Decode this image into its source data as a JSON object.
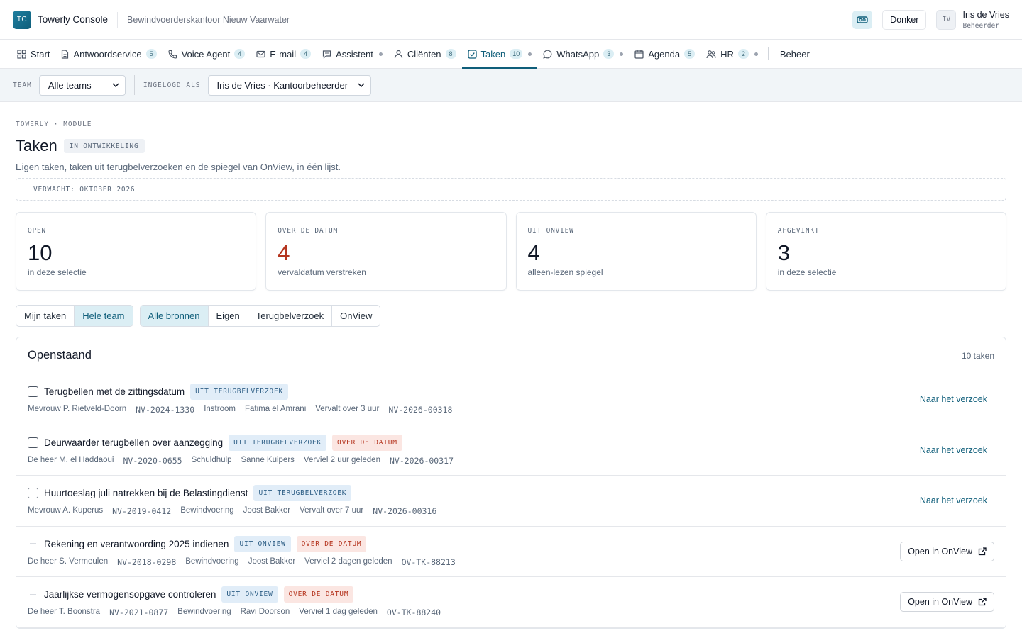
{
  "header": {
    "logo_text": "TC",
    "app_title": "Towerly Console",
    "office": "Bewindvoerderskantoor Nieuw Vaarwater",
    "theme_label": "Donker",
    "user": {
      "initials": "IV",
      "name": "Iris de Vries",
      "role": "Beheerder"
    }
  },
  "nav": {
    "items": [
      {
        "label": "Start",
        "icon": "grid-icon"
      },
      {
        "label": "Antwoordservice",
        "icon": "document-icon",
        "count": "5"
      },
      {
        "label": "Voice Agent",
        "icon": "phone-icon",
        "count": "4"
      },
      {
        "label": "E-mail",
        "icon": "mail-icon",
        "count": "4"
      },
      {
        "label": "Assistent",
        "icon": "chat-icon"
      },
      {
        "label": "Cliënten",
        "icon": "user-icon",
        "count": "8"
      },
      {
        "label": "Taken",
        "icon": "checkbox-icon",
        "count": "10"
      },
      {
        "label": "WhatsApp",
        "icon": "whatsapp-icon",
        "count": "3"
      },
      {
        "label": "Agenda",
        "icon": "calendar-icon",
        "count": "5"
      },
      {
        "label": "HR",
        "icon": "people-icon",
        "count": "2"
      }
    ],
    "admin_label": "Beheer"
  },
  "filters": {
    "team_label": "TEAM",
    "team_value": "Alle teams",
    "login_label": "INGELOGD ALS",
    "login_value": "Iris de Vries · Kantoorbeheerder"
  },
  "page": {
    "eyebrow": "TOWERLY · MODULE",
    "title": "Taken",
    "status": "IN ONTWIKKELING",
    "subtitle": "Eigen taken, taken uit terugbelverzoeken en de spiegel van OnView, in één lijst.",
    "expected": "VERWACHT: OKTOBER 2026"
  },
  "stats": [
    {
      "label": "OPEN",
      "value": "10",
      "sub": "in deze selectie"
    },
    {
      "label": "OVER DE DATUM",
      "value": "4",
      "sub": "vervaldatum verstreken"
    },
    {
      "label": "UIT ONVIEW",
      "value": "4",
      "sub": "alleen-lezen spiegel"
    },
    {
      "label": "AFGEVINKT",
      "value": "3",
      "sub": "in deze selectie"
    }
  ],
  "scope_tabs": [
    "Mijn taken",
    "Hele team"
  ],
  "source_tabs": [
    "Alle bronnen",
    "Eigen",
    "Terugbelverzoek",
    "OnView"
  ],
  "list": {
    "title": "Openstaand",
    "count": "10 taken",
    "tasks": [
      {
        "title": "Terugbellen met de zittingsdatum",
        "source_tag": "UIT TERUGBELVERZOEK",
        "meta": [
          "Mevrouw P. Rietveld-Doorn",
          "NV-2024-1330",
          "Instroom",
          "Fatima el Amrani",
          "Vervalt over 3 uur",
          "NV-2026-00318"
        ],
        "action": "Naar het verzoek"
      },
      {
        "title": "Deurwaarder terugbellen over aanzegging",
        "source_tag": "UIT TERUGBELVERZOEK",
        "status_tag": "OVER DE DATUM",
        "meta": [
          "De heer M. el Haddaoui",
          "NV-2020-0655",
          "Schuldhulp",
          "Sanne Kuipers",
          "Verviel 2 uur geleden",
          "NV-2026-00317"
        ],
        "action": "Naar het verzoek"
      },
      {
        "title": "Huurtoeslag juli natrekken bij de Belastingdienst",
        "source_tag": "UIT TERUGBELVERZOEK",
        "meta": [
          "Mevrouw A. Kuperus",
          "NV-2019-0412",
          "Bewindvoering",
          "Joost Bakker",
          "Vervalt over 7 uur",
          "NV-2026-00316"
        ],
        "action": "Naar het verzoek"
      },
      {
        "title": "Rekening en verantwoording 2025 indienen",
        "source_tag": "UIT ONVIEW",
        "status_tag": "OVER DE DATUM",
        "meta": [
          "De heer S. Vermeulen",
          "NV-2018-0298",
          "Bewindvoering",
          "Joost Bakker",
          "Verviel 2 dagen geleden",
          "OV-TK-88213"
        ],
        "action": "Open in OnView"
      },
      {
        "title": "Jaarlijkse vermogensopgave controleren",
        "source_tag": "UIT ONVIEW",
        "status_tag": "OVER DE DATUM",
        "meta": [
          "De heer T. Boonstra",
          "NV-2021-0877",
          "Bewindvoering",
          "Ravi Doorson",
          "Verviel 1 dag geleden",
          "OV-TK-88240"
        ],
        "action": "Open in OnView"
      }
    ]
  }
}
